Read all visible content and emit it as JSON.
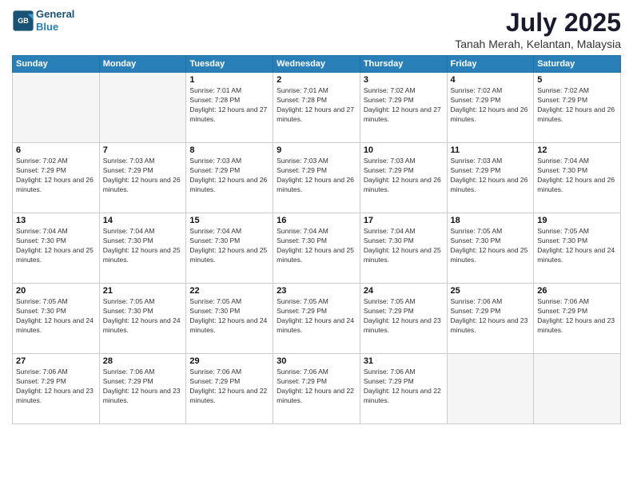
{
  "header": {
    "logo": {
      "line1": "General",
      "line2": "Blue"
    },
    "title": "July 2025",
    "location": "Tanah Merah, Kelantan, Malaysia"
  },
  "weekdays": [
    "Sunday",
    "Monday",
    "Tuesday",
    "Wednesday",
    "Thursday",
    "Friday",
    "Saturday"
  ],
  "weeks": [
    [
      {
        "day": "",
        "empty": true
      },
      {
        "day": "",
        "empty": true
      },
      {
        "day": "1",
        "sunrise": "7:01 AM",
        "sunset": "7:28 PM",
        "daylight": "12 hours and 27 minutes."
      },
      {
        "day": "2",
        "sunrise": "7:01 AM",
        "sunset": "7:28 PM",
        "daylight": "12 hours and 27 minutes."
      },
      {
        "day": "3",
        "sunrise": "7:02 AM",
        "sunset": "7:29 PM",
        "daylight": "12 hours and 27 minutes."
      },
      {
        "day": "4",
        "sunrise": "7:02 AM",
        "sunset": "7:29 PM",
        "daylight": "12 hours and 26 minutes."
      },
      {
        "day": "5",
        "sunrise": "7:02 AM",
        "sunset": "7:29 PM",
        "daylight": "12 hours and 26 minutes."
      }
    ],
    [
      {
        "day": "6",
        "sunrise": "7:02 AM",
        "sunset": "7:29 PM",
        "daylight": "12 hours and 26 minutes."
      },
      {
        "day": "7",
        "sunrise": "7:03 AM",
        "sunset": "7:29 PM",
        "daylight": "12 hours and 26 minutes."
      },
      {
        "day": "8",
        "sunrise": "7:03 AM",
        "sunset": "7:29 PM",
        "daylight": "12 hours and 26 minutes."
      },
      {
        "day": "9",
        "sunrise": "7:03 AM",
        "sunset": "7:29 PM",
        "daylight": "12 hours and 26 minutes."
      },
      {
        "day": "10",
        "sunrise": "7:03 AM",
        "sunset": "7:29 PM",
        "daylight": "12 hours and 26 minutes."
      },
      {
        "day": "11",
        "sunrise": "7:03 AM",
        "sunset": "7:29 PM",
        "daylight": "12 hours and 26 minutes."
      },
      {
        "day": "12",
        "sunrise": "7:04 AM",
        "sunset": "7:30 PM",
        "daylight": "12 hours and 26 minutes."
      }
    ],
    [
      {
        "day": "13",
        "sunrise": "7:04 AM",
        "sunset": "7:30 PM",
        "daylight": "12 hours and 25 minutes."
      },
      {
        "day": "14",
        "sunrise": "7:04 AM",
        "sunset": "7:30 PM",
        "daylight": "12 hours and 25 minutes."
      },
      {
        "day": "15",
        "sunrise": "7:04 AM",
        "sunset": "7:30 PM",
        "daylight": "12 hours and 25 minutes."
      },
      {
        "day": "16",
        "sunrise": "7:04 AM",
        "sunset": "7:30 PM",
        "daylight": "12 hours and 25 minutes."
      },
      {
        "day": "17",
        "sunrise": "7:04 AM",
        "sunset": "7:30 PM",
        "daylight": "12 hours and 25 minutes."
      },
      {
        "day": "18",
        "sunrise": "7:05 AM",
        "sunset": "7:30 PM",
        "daylight": "12 hours and 25 minutes."
      },
      {
        "day": "19",
        "sunrise": "7:05 AM",
        "sunset": "7:30 PM",
        "daylight": "12 hours and 24 minutes."
      }
    ],
    [
      {
        "day": "20",
        "sunrise": "7:05 AM",
        "sunset": "7:30 PM",
        "daylight": "12 hours and 24 minutes."
      },
      {
        "day": "21",
        "sunrise": "7:05 AM",
        "sunset": "7:30 PM",
        "daylight": "12 hours and 24 minutes."
      },
      {
        "day": "22",
        "sunrise": "7:05 AM",
        "sunset": "7:30 PM",
        "daylight": "12 hours and 24 minutes."
      },
      {
        "day": "23",
        "sunrise": "7:05 AM",
        "sunset": "7:29 PM",
        "daylight": "12 hours and 24 minutes."
      },
      {
        "day": "24",
        "sunrise": "7:05 AM",
        "sunset": "7:29 PM",
        "daylight": "12 hours and 23 minutes."
      },
      {
        "day": "25",
        "sunrise": "7:06 AM",
        "sunset": "7:29 PM",
        "daylight": "12 hours and 23 minutes."
      },
      {
        "day": "26",
        "sunrise": "7:06 AM",
        "sunset": "7:29 PM",
        "daylight": "12 hours and 23 minutes."
      }
    ],
    [
      {
        "day": "27",
        "sunrise": "7:06 AM",
        "sunset": "7:29 PM",
        "daylight": "12 hours and 23 minutes."
      },
      {
        "day": "28",
        "sunrise": "7:06 AM",
        "sunset": "7:29 PM",
        "daylight": "12 hours and 23 minutes."
      },
      {
        "day": "29",
        "sunrise": "7:06 AM",
        "sunset": "7:29 PM",
        "daylight": "12 hours and 22 minutes."
      },
      {
        "day": "30",
        "sunrise": "7:06 AM",
        "sunset": "7:29 PM",
        "daylight": "12 hours and 22 minutes."
      },
      {
        "day": "31",
        "sunrise": "7:06 AM",
        "sunset": "7:29 PM",
        "daylight": "12 hours and 22 minutes."
      },
      {
        "day": "",
        "empty": true
      },
      {
        "day": "",
        "empty": true
      }
    ]
  ],
  "labels": {
    "sunrise": "Sunrise:",
    "sunset": "Sunset:",
    "daylight": "Daylight:"
  }
}
